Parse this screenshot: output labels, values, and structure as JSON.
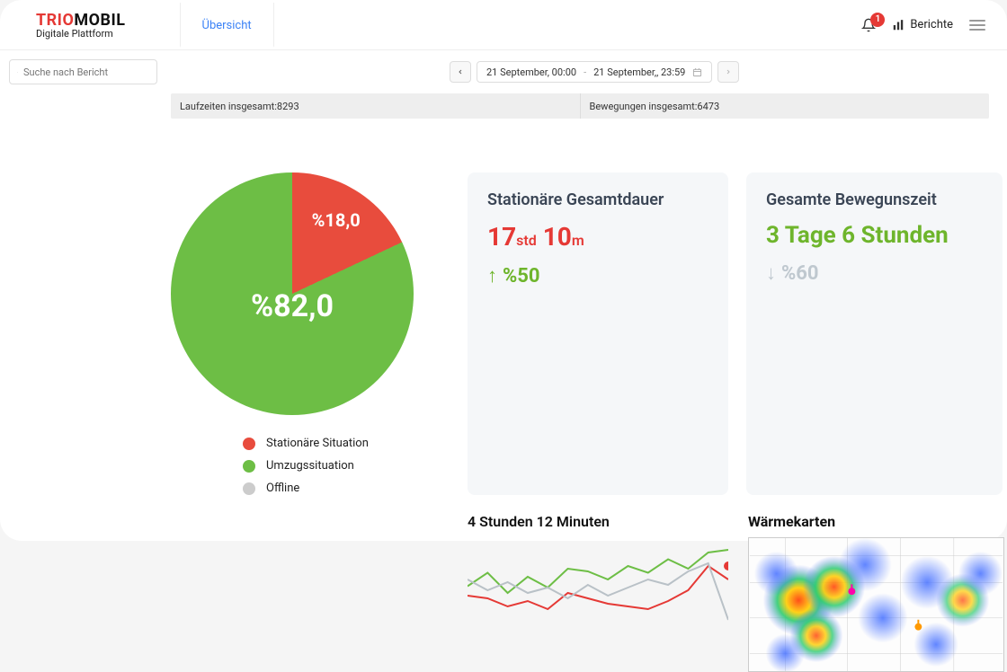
{
  "brand": {
    "part1": "TRIO",
    "part2": "MOBIL",
    "subtitle": "Digitale Plattform"
  },
  "tabs": {
    "overview": "Übersicht"
  },
  "header": {
    "notification_count": "1",
    "reports_label": "Berichte"
  },
  "search": {
    "placeholder": "Suche nach Bericht"
  },
  "date_range": {
    "from": "21 September, 00:00",
    "to": "21 September,, 23:59"
  },
  "stat_bar": {
    "runtimes_label": "Laufzeiten insgesamt:",
    "runtimes_value": "8293",
    "movements_label": "Bewegungen insgesamt: ",
    "movements_value": "6473"
  },
  "pie": {
    "slice_stationary_label": "%18,0",
    "slice_moving_label": "%82,0",
    "legend_stationary": "Stationäre Situation",
    "legend_moving": "Umzugssituation",
    "legend_offline": "Offline"
  },
  "card_stationary": {
    "title": "Stationäre Gesamtdauer",
    "value_h": "17",
    "unit_h": "std",
    "value_m": "10",
    "unit_m": "m",
    "delta": "%50"
  },
  "card_moving": {
    "title": "Gesamte Bewegunszeit",
    "value": "3 Tage 6 Stunden",
    "delta": "%60"
  },
  "mini_chart": {
    "title": "4 Stunden 12 Minuten"
  },
  "heatmap": {
    "title": "Wärmekarten"
  },
  "chart_data": {
    "pie": {
      "type": "pie",
      "series": [
        {
          "name": "Stationäre Situation",
          "value": 18.0,
          "color": "#E84C3D"
        },
        {
          "name": "Umzugssituation",
          "value": 82.0,
          "color": "#6DBE45"
        },
        {
          "name": "Offline",
          "value": 0.0,
          "color": "#cccccc"
        }
      ]
    },
    "mini_line": {
      "type": "line",
      "x": [
        0,
        1,
        2,
        3,
        4,
        5,
        6,
        7,
        8,
        9,
        10,
        11,
        12,
        13
      ],
      "series": [
        {
          "name": "green",
          "color": "#6DBE45",
          "values": [
            45,
            55,
            40,
            52,
            44,
            58,
            56,
            50,
            60,
            55,
            65,
            58,
            70,
            72
          ]
        },
        {
          "name": "red",
          "color": "#E53935",
          "values": [
            38,
            36,
            30,
            34,
            28,
            40,
            36,
            32,
            30,
            28,
            34,
            42,
            60,
            50
          ]
        },
        {
          "name": "grey",
          "color": "#B9C1C7",
          "values": [
            50,
            42,
            48,
            40,
            44,
            36,
            46,
            38,
            44,
            50,
            46,
            56,
            62,
            20
          ]
        }
      ],
      "ylim": [
        0,
        80
      ],
      "marker": {
        "x": 13,
        "y": 60,
        "color": "#E53935"
      }
    }
  }
}
